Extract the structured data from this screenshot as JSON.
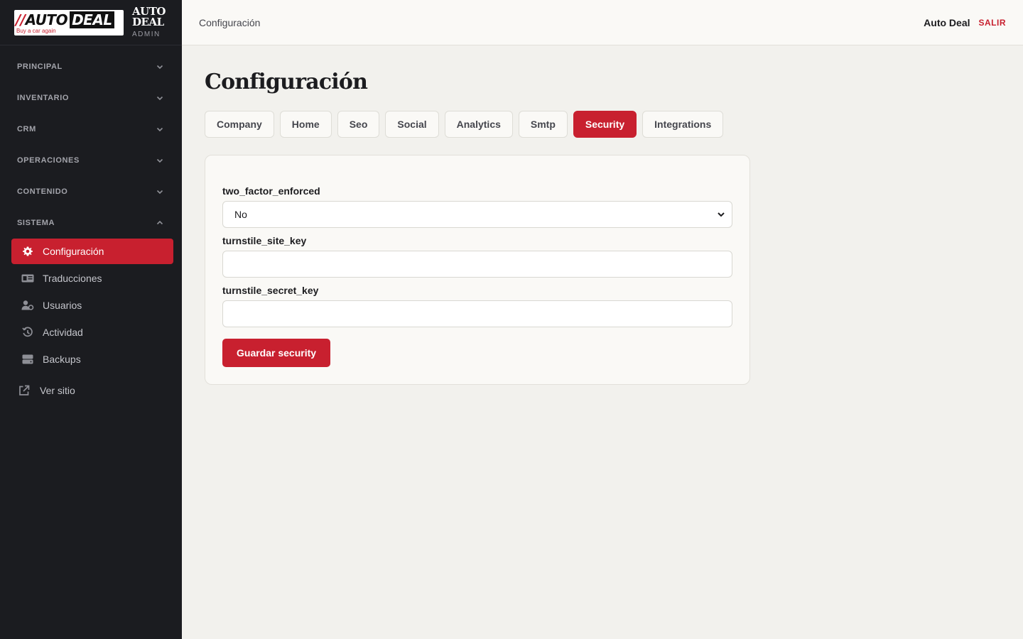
{
  "brand": {
    "logo_slash": "//",
    "logo_auto": "AUTO",
    "logo_deal": "DEAL",
    "logo_tagline": "Buy a car again",
    "title": "AUTO DEAL",
    "subtitle": "ADMIN"
  },
  "sidebar": {
    "sections": [
      {
        "label": "PRINCIPAL"
      },
      {
        "label": "INVENTARIO"
      },
      {
        "label": "CRM"
      },
      {
        "label": "OPERACIONES"
      },
      {
        "label": "CONTENIDO"
      },
      {
        "label": "SISTEMA"
      }
    ],
    "items": [
      {
        "label": "Configuración",
        "icon": "gear-icon",
        "active": true
      },
      {
        "label": "Traducciones",
        "icon": "translate-icon"
      },
      {
        "label": "Usuarios",
        "icon": "users-icon"
      },
      {
        "label": "Actividad",
        "icon": "history-icon"
      },
      {
        "label": "Backups",
        "icon": "server-icon"
      }
    ],
    "external": {
      "label": "Ver sitio",
      "icon": "external-link-icon"
    }
  },
  "topbar": {
    "breadcrumb": "Configuración",
    "user": "Auto Deal",
    "logout": "SALIR"
  },
  "main": {
    "title": "Configuración",
    "tabs": [
      {
        "label": "Company"
      },
      {
        "label": "Home"
      },
      {
        "label": "Seo"
      },
      {
        "label": "Social"
      },
      {
        "label": "Analytics"
      },
      {
        "label": "Smtp"
      },
      {
        "label": "Security",
        "active": true
      },
      {
        "label": "Integrations"
      }
    ],
    "form": {
      "two_factor_label": "two_factor_enforced",
      "two_factor_value": "No",
      "site_key_label": "turnstile_site_key",
      "site_key_value": "",
      "secret_key_label": "turnstile_secret_key",
      "secret_key_value": "",
      "save_label": "Guardar security"
    }
  },
  "colors": {
    "accent": "#c8202f",
    "sidebar_bg": "#1b1c20",
    "page_bg": "#f2f1ed"
  }
}
